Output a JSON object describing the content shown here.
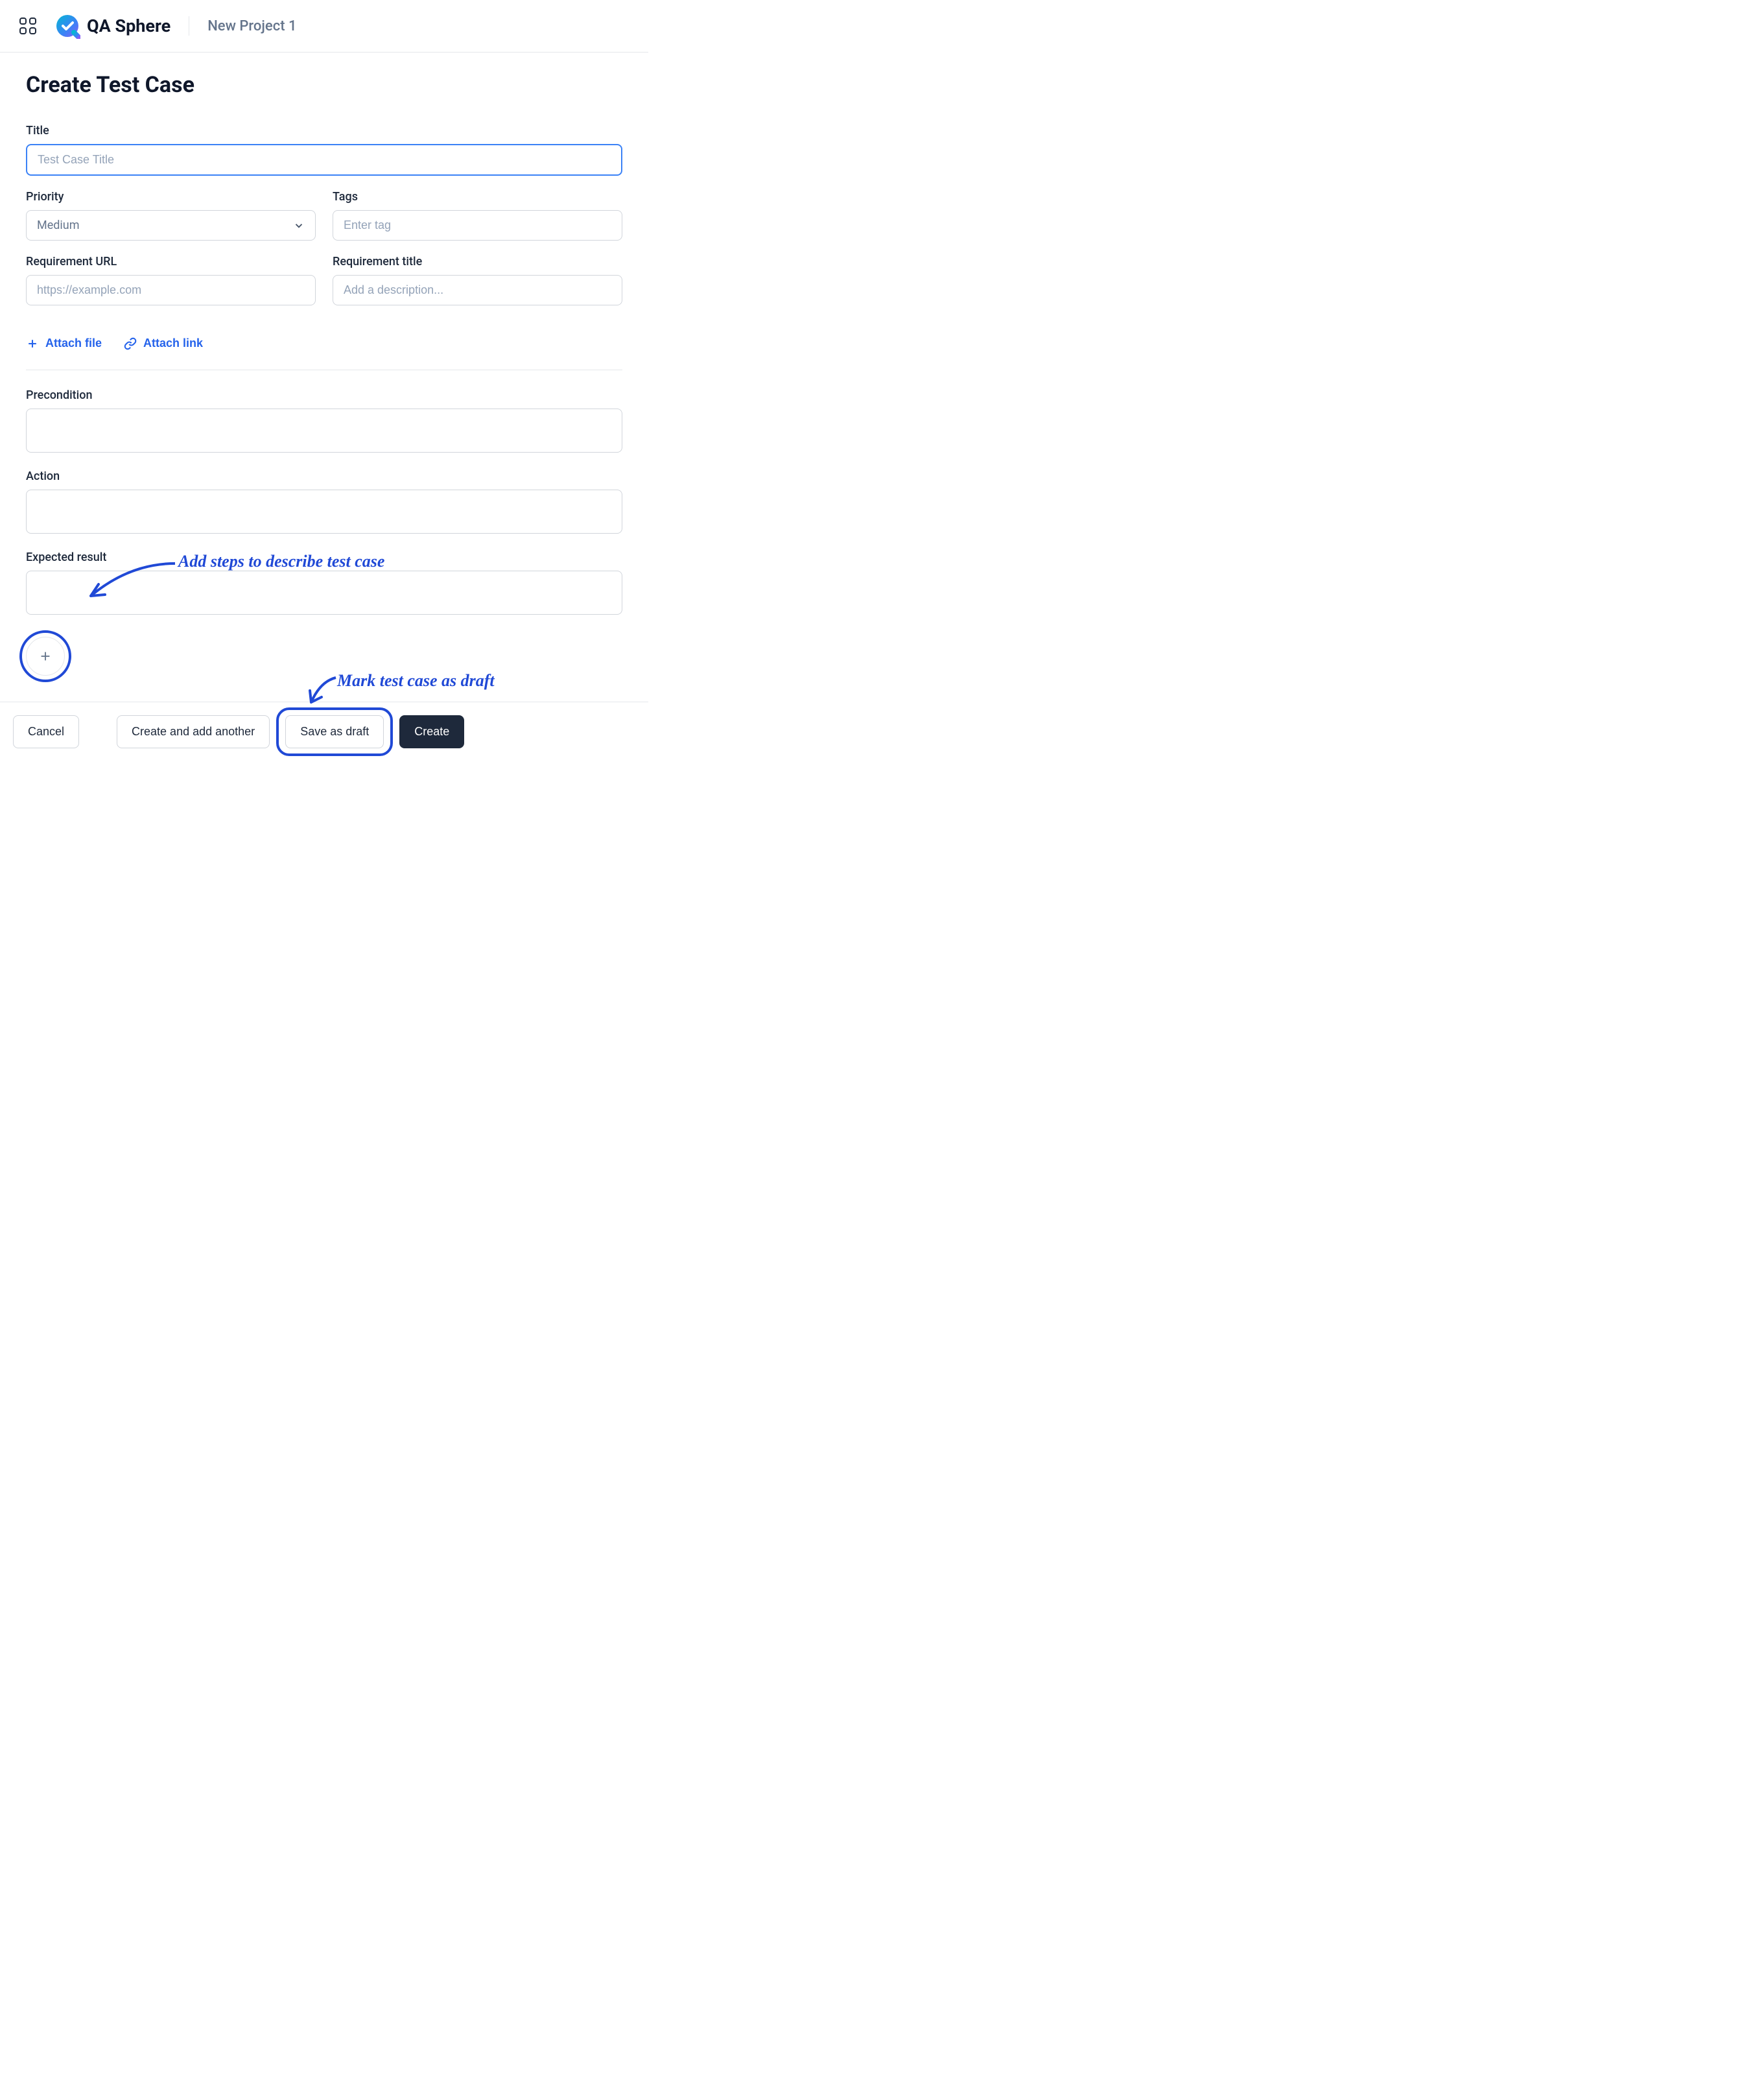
{
  "header": {
    "app_name": "QA Sphere",
    "project_name": "New Project 1"
  },
  "page": {
    "title": "Create Test Case",
    "fields": {
      "title": {
        "label": "Title",
        "placeholder": "Test Case Title"
      },
      "priority": {
        "label": "Priority",
        "value": "Medium"
      },
      "tags": {
        "label": "Tags",
        "placeholder": "Enter tag"
      },
      "req_url": {
        "label": "Requirement URL",
        "placeholder": "https://example.com"
      },
      "req_title": {
        "label": "Requirement title",
        "placeholder": "Add a description..."
      },
      "precondition": {
        "label": "Precondition"
      },
      "action": {
        "label": "Action"
      },
      "expected": {
        "label": "Expected result"
      }
    },
    "attach": {
      "file": "Attach file",
      "link": "Attach link"
    }
  },
  "footer": {
    "cancel": "Cancel",
    "create_another": "Create and add another",
    "save_draft": "Save as draft",
    "create": "Create"
  },
  "annotations": {
    "steps_note": "Add steps to describe test case",
    "draft_note": "Mark test case as draft"
  }
}
